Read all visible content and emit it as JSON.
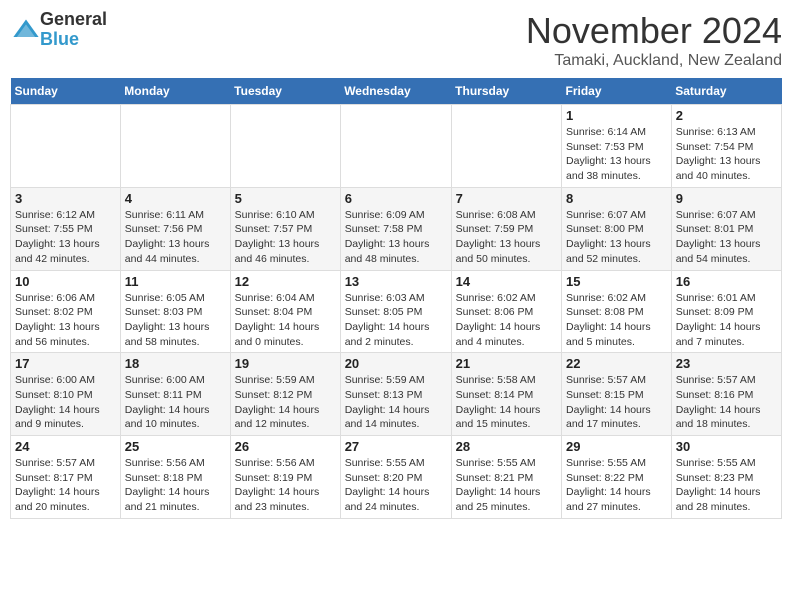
{
  "header": {
    "logo_general": "General",
    "logo_blue": "Blue",
    "month_title": "November 2024",
    "location": "Tamaki, Auckland, New Zealand"
  },
  "days_of_week": [
    "Sunday",
    "Monday",
    "Tuesday",
    "Wednesday",
    "Thursday",
    "Friday",
    "Saturday"
  ],
  "weeks": [
    [
      {
        "num": "",
        "info": ""
      },
      {
        "num": "",
        "info": ""
      },
      {
        "num": "",
        "info": ""
      },
      {
        "num": "",
        "info": ""
      },
      {
        "num": "",
        "info": ""
      },
      {
        "num": "1",
        "info": "Sunrise: 6:14 AM\nSunset: 7:53 PM\nDaylight: 13 hours and 38 minutes."
      },
      {
        "num": "2",
        "info": "Sunrise: 6:13 AM\nSunset: 7:54 PM\nDaylight: 13 hours and 40 minutes."
      }
    ],
    [
      {
        "num": "3",
        "info": "Sunrise: 6:12 AM\nSunset: 7:55 PM\nDaylight: 13 hours and 42 minutes."
      },
      {
        "num": "4",
        "info": "Sunrise: 6:11 AM\nSunset: 7:56 PM\nDaylight: 13 hours and 44 minutes."
      },
      {
        "num": "5",
        "info": "Sunrise: 6:10 AM\nSunset: 7:57 PM\nDaylight: 13 hours and 46 minutes."
      },
      {
        "num": "6",
        "info": "Sunrise: 6:09 AM\nSunset: 7:58 PM\nDaylight: 13 hours and 48 minutes."
      },
      {
        "num": "7",
        "info": "Sunrise: 6:08 AM\nSunset: 7:59 PM\nDaylight: 13 hours and 50 minutes."
      },
      {
        "num": "8",
        "info": "Sunrise: 6:07 AM\nSunset: 8:00 PM\nDaylight: 13 hours and 52 minutes."
      },
      {
        "num": "9",
        "info": "Sunrise: 6:07 AM\nSunset: 8:01 PM\nDaylight: 13 hours and 54 minutes."
      }
    ],
    [
      {
        "num": "10",
        "info": "Sunrise: 6:06 AM\nSunset: 8:02 PM\nDaylight: 13 hours and 56 minutes."
      },
      {
        "num": "11",
        "info": "Sunrise: 6:05 AM\nSunset: 8:03 PM\nDaylight: 13 hours and 58 minutes."
      },
      {
        "num": "12",
        "info": "Sunrise: 6:04 AM\nSunset: 8:04 PM\nDaylight: 14 hours and 0 minutes."
      },
      {
        "num": "13",
        "info": "Sunrise: 6:03 AM\nSunset: 8:05 PM\nDaylight: 14 hours and 2 minutes."
      },
      {
        "num": "14",
        "info": "Sunrise: 6:02 AM\nSunset: 8:06 PM\nDaylight: 14 hours and 4 minutes."
      },
      {
        "num": "15",
        "info": "Sunrise: 6:02 AM\nSunset: 8:08 PM\nDaylight: 14 hours and 5 minutes."
      },
      {
        "num": "16",
        "info": "Sunrise: 6:01 AM\nSunset: 8:09 PM\nDaylight: 14 hours and 7 minutes."
      }
    ],
    [
      {
        "num": "17",
        "info": "Sunrise: 6:00 AM\nSunset: 8:10 PM\nDaylight: 14 hours and 9 minutes."
      },
      {
        "num": "18",
        "info": "Sunrise: 6:00 AM\nSunset: 8:11 PM\nDaylight: 14 hours and 10 minutes."
      },
      {
        "num": "19",
        "info": "Sunrise: 5:59 AM\nSunset: 8:12 PM\nDaylight: 14 hours and 12 minutes."
      },
      {
        "num": "20",
        "info": "Sunrise: 5:59 AM\nSunset: 8:13 PM\nDaylight: 14 hours and 14 minutes."
      },
      {
        "num": "21",
        "info": "Sunrise: 5:58 AM\nSunset: 8:14 PM\nDaylight: 14 hours and 15 minutes."
      },
      {
        "num": "22",
        "info": "Sunrise: 5:57 AM\nSunset: 8:15 PM\nDaylight: 14 hours and 17 minutes."
      },
      {
        "num": "23",
        "info": "Sunrise: 5:57 AM\nSunset: 8:16 PM\nDaylight: 14 hours and 18 minutes."
      }
    ],
    [
      {
        "num": "24",
        "info": "Sunrise: 5:57 AM\nSunset: 8:17 PM\nDaylight: 14 hours and 20 minutes."
      },
      {
        "num": "25",
        "info": "Sunrise: 5:56 AM\nSunset: 8:18 PM\nDaylight: 14 hours and 21 minutes."
      },
      {
        "num": "26",
        "info": "Sunrise: 5:56 AM\nSunset: 8:19 PM\nDaylight: 14 hours and 23 minutes."
      },
      {
        "num": "27",
        "info": "Sunrise: 5:55 AM\nSunset: 8:20 PM\nDaylight: 14 hours and 24 minutes."
      },
      {
        "num": "28",
        "info": "Sunrise: 5:55 AM\nSunset: 8:21 PM\nDaylight: 14 hours and 25 minutes."
      },
      {
        "num": "29",
        "info": "Sunrise: 5:55 AM\nSunset: 8:22 PM\nDaylight: 14 hours and 27 minutes."
      },
      {
        "num": "30",
        "info": "Sunrise: 5:55 AM\nSunset: 8:23 PM\nDaylight: 14 hours and 28 minutes."
      }
    ]
  ]
}
